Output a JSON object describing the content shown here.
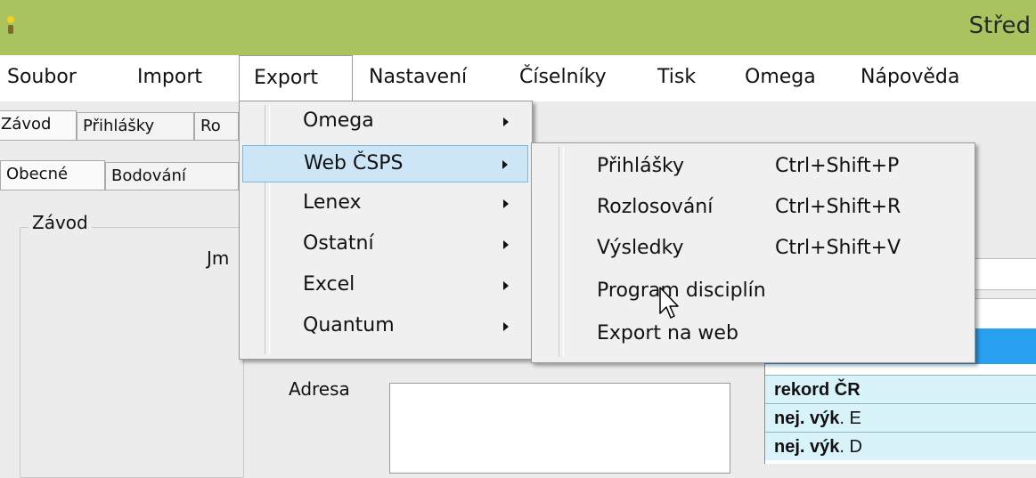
{
  "window": {
    "title": "Střed"
  },
  "menubar": {
    "items": [
      "Soubor",
      "Import",
      "Export",
      "Nastavení",
      "Číselníky",
      "Tisk",
      "Omega",
      "Nápověda"
    ]
  },
  "tabs_main": [
    "Závod",
    "Přihlášky",
    "Ro"
  ],
  "tabs_sub": [
    "Obecné",
    "Bodování"
  ],
  "form": {
    "group_title": "Závod",
    "name_label": "Jm",
    "address_label": "Adresa"
  },
  "export_menu": [
    {
      "label": "Omega",
      "submenu": true
    },
    {
      "label": "Web ČSPS",
      "submenu": true,
      "highlighted": true
    },
    {
      "label": "Lenex",
      "submenu": true
    },
    {
      "label": "Ostatní",
      "submenu": true
    },
    {
      "label": "Excel",
      "submenu": true
    },
    {
      "label": "Quantum",
      "submenu": true
    }
  ],
  "web_cspc_menu": [
    {
      "label": "Přihlášky",
      "shortcut": "Ctrl+Shift+P"
    },
    {
      "label": "Rozlosování",
      "shortcut": "Ctrl+Shift+R"
    },
    {
      "label": "Výsledky",
      "shortcut": "Ctrl+Shift+V"
    },
    {
      "label": "Program disciplín",
      "shortcut": ""
    },
    {
      "label": "Export na web",
      "shortcut": ""
    }
  ],
  "grid": {
    "rows": [
      {
        "bold": "rekord ČR",
        "rest": ""
      },
      {
        "bold": "nej. výk",
        "rest": ". E"
      },
      {
        "bold": "nej. výk",
        "rest": ". D"
      }
    ]
  },
  "colors": {
    "titlebar": "#a9c45f",
    "grid_header": "#2aa0f0",
    "grid_row": "#d9f3fb",
    "menu_highlight": "#cde6f7"
  }
}
